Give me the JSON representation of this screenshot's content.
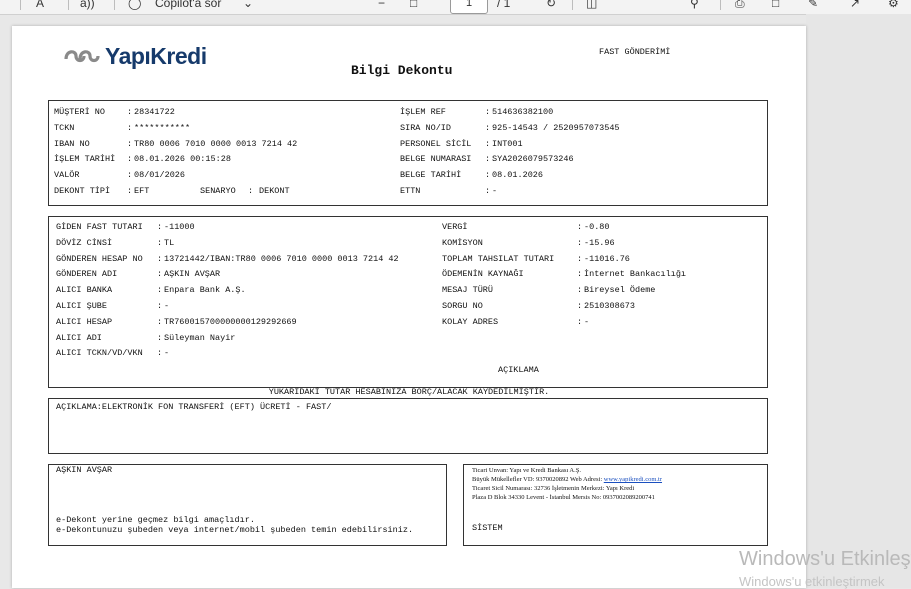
{
  "toolbar": {
    "copilot_label": "Copilot'a sor",
    "page_number": "1",
    "page_total": "/ 1"
  },
  "header": {
    "brand": "YapıKredi",
    "title": "Bilgi Dekontu",
    "fast_label": "FAST GÖNDERİMİ"
  },
  "customer": {
    "left": [
      {
        "label": "MÜŞTERİ NO",
        "value": "28341722"
      },
      {
        "label": "TCKN",
        "value": "***********"
      },
      {
        "label": "IBAN NO",
        "value": "TR80 0006 7010 0000 0013 7214 42"
      },
      {
        "label": "İŞLEM TARİHİ",
        "value": "08.01.2026 00:15:28"
      },
      {
        "label": "VALÖR",
        "value": "08/01/2026"
      },
      {
        "label": "DEKONT TİPİ",
        "value": "EFT"
      }
    ],
    "senaryo_label": "SENARYO",
    "senaryo_value": "DEKONT",
    "right": [
      {
        "label": "İŞLEM REF",
        "value": "514636382100"
      },
      {
        "label": "SIRA NO/ID",
        "value": "925-14543 / 2520957073545"
      },
      {
        "label": "PERSONEL SİCİL",
        "value": "INT001"
      },
      {
        "label": "BELGE NUMARASI",
        "value": "SYA2026079573246"
      },
      {
        "label": "BELGE TARİHİ",
        "value": "08.01.2026"
      },
      {
        "label": "ETTN",
        "value": "-"
      }
    ]
  },
  "transfer": {
    "left": [
      {
        "label": "GİDEN FAST TUTARI",
        "value": "-11000"
      },
      {
        "label": "DÖVİZ CİNSİ",
        "value": "TL"
      },
      {
        "label": "GÖNDEREN HESAP NO",
        "value": "13721442/IBAN:TR80 0006 7010 0000 0013 7214 42"
      },
      {
        "label": "GÖNDEREN ADI",
        "value": "AŞKIN AVŞAR"
      },
      {
        "label": "ALICI BANKA",
        "value": "Enpara Bank A.Ş."
      },
      {
        "label": "ALICI ŞUBE",
        "value": "-"
      },
      {
        "label": "ALICI HESAP",
        "value": "TR760015700000000129292669"
      },
      {
        "label": "ALICI ADI",
        "value": "Süleyman Nayir"
      },
      {
        "label": "ALICI TCKN/VD/VKN",
        "value": "-"
      }
    ],
    "right": [
      {
        "label": "VERGİ",
        "value": "-0.80"
      },
      {
        "label": "KOMİSYON",
        "value": "-15.96"
      },
      {
        "label": "TOPLAM TAHSILAT TUTARI",
        "value": "-11016.76"
      },
      {
        "label": "ÖDEMENİN KAYNAĞI",
        "value": "İnternet Bankacılığı"
      },
      {
        "label": "MESAJ TÜRÜ",
        "value": "Bireysel Ödeme"
      },
      {
        "label": "SORGU NO",
        "value": "2510308673"
      },
      {
        "label": "KOLAY ADRES",
        "value": "-"
      }
    ],
    "aciklama_heading": "AÇIKLAMA"
  },
  "notice": "YUKARIDAKİ TUTAR HESABINIZA BORÇ/ALACAK KAYDEDİLMİŞTİR.",
  "description": "AÇIKLAMA:ELEKTRONİK FON TRANSFERİ (EFT) ÜCRETİ - FAST/",
  "footer": {
    "customer_name": "AŞKIN AVŞAR",
    "disclaimer_1": "e-Dekont yerine geçmez bilgi amaçlıdır.",
    "disclaimer_2": "e-Dekontunuzu şubeden veya internet/mobil şubeden temin edebilirsiniz.",
    "bank_info_1": "Ticari Unvan: Yapı ve Kredi Bankası A.Ş.",
    "bank_info_2a": "Büyük Mükellefler VD: 9370020892 Web Adresi: ",
    "bank_info_2b": "www.yapikredi.com.tr",
    "bank_info_3": "Ticaret Sicil Numarası: 32736 İşletmenin Merkezi: Yapı Kredi",
    "bank_info_4": "Plaza D Blok 34330 Levent - İstanbul Mersis No: 0937002089200741",
    "system_label": "SİSTEM"
  },
  "watermark": {
    "line1": "Windows'u Etkinleştir",
    "line2": "Windows'u etkinleştirmek"
  }
}
